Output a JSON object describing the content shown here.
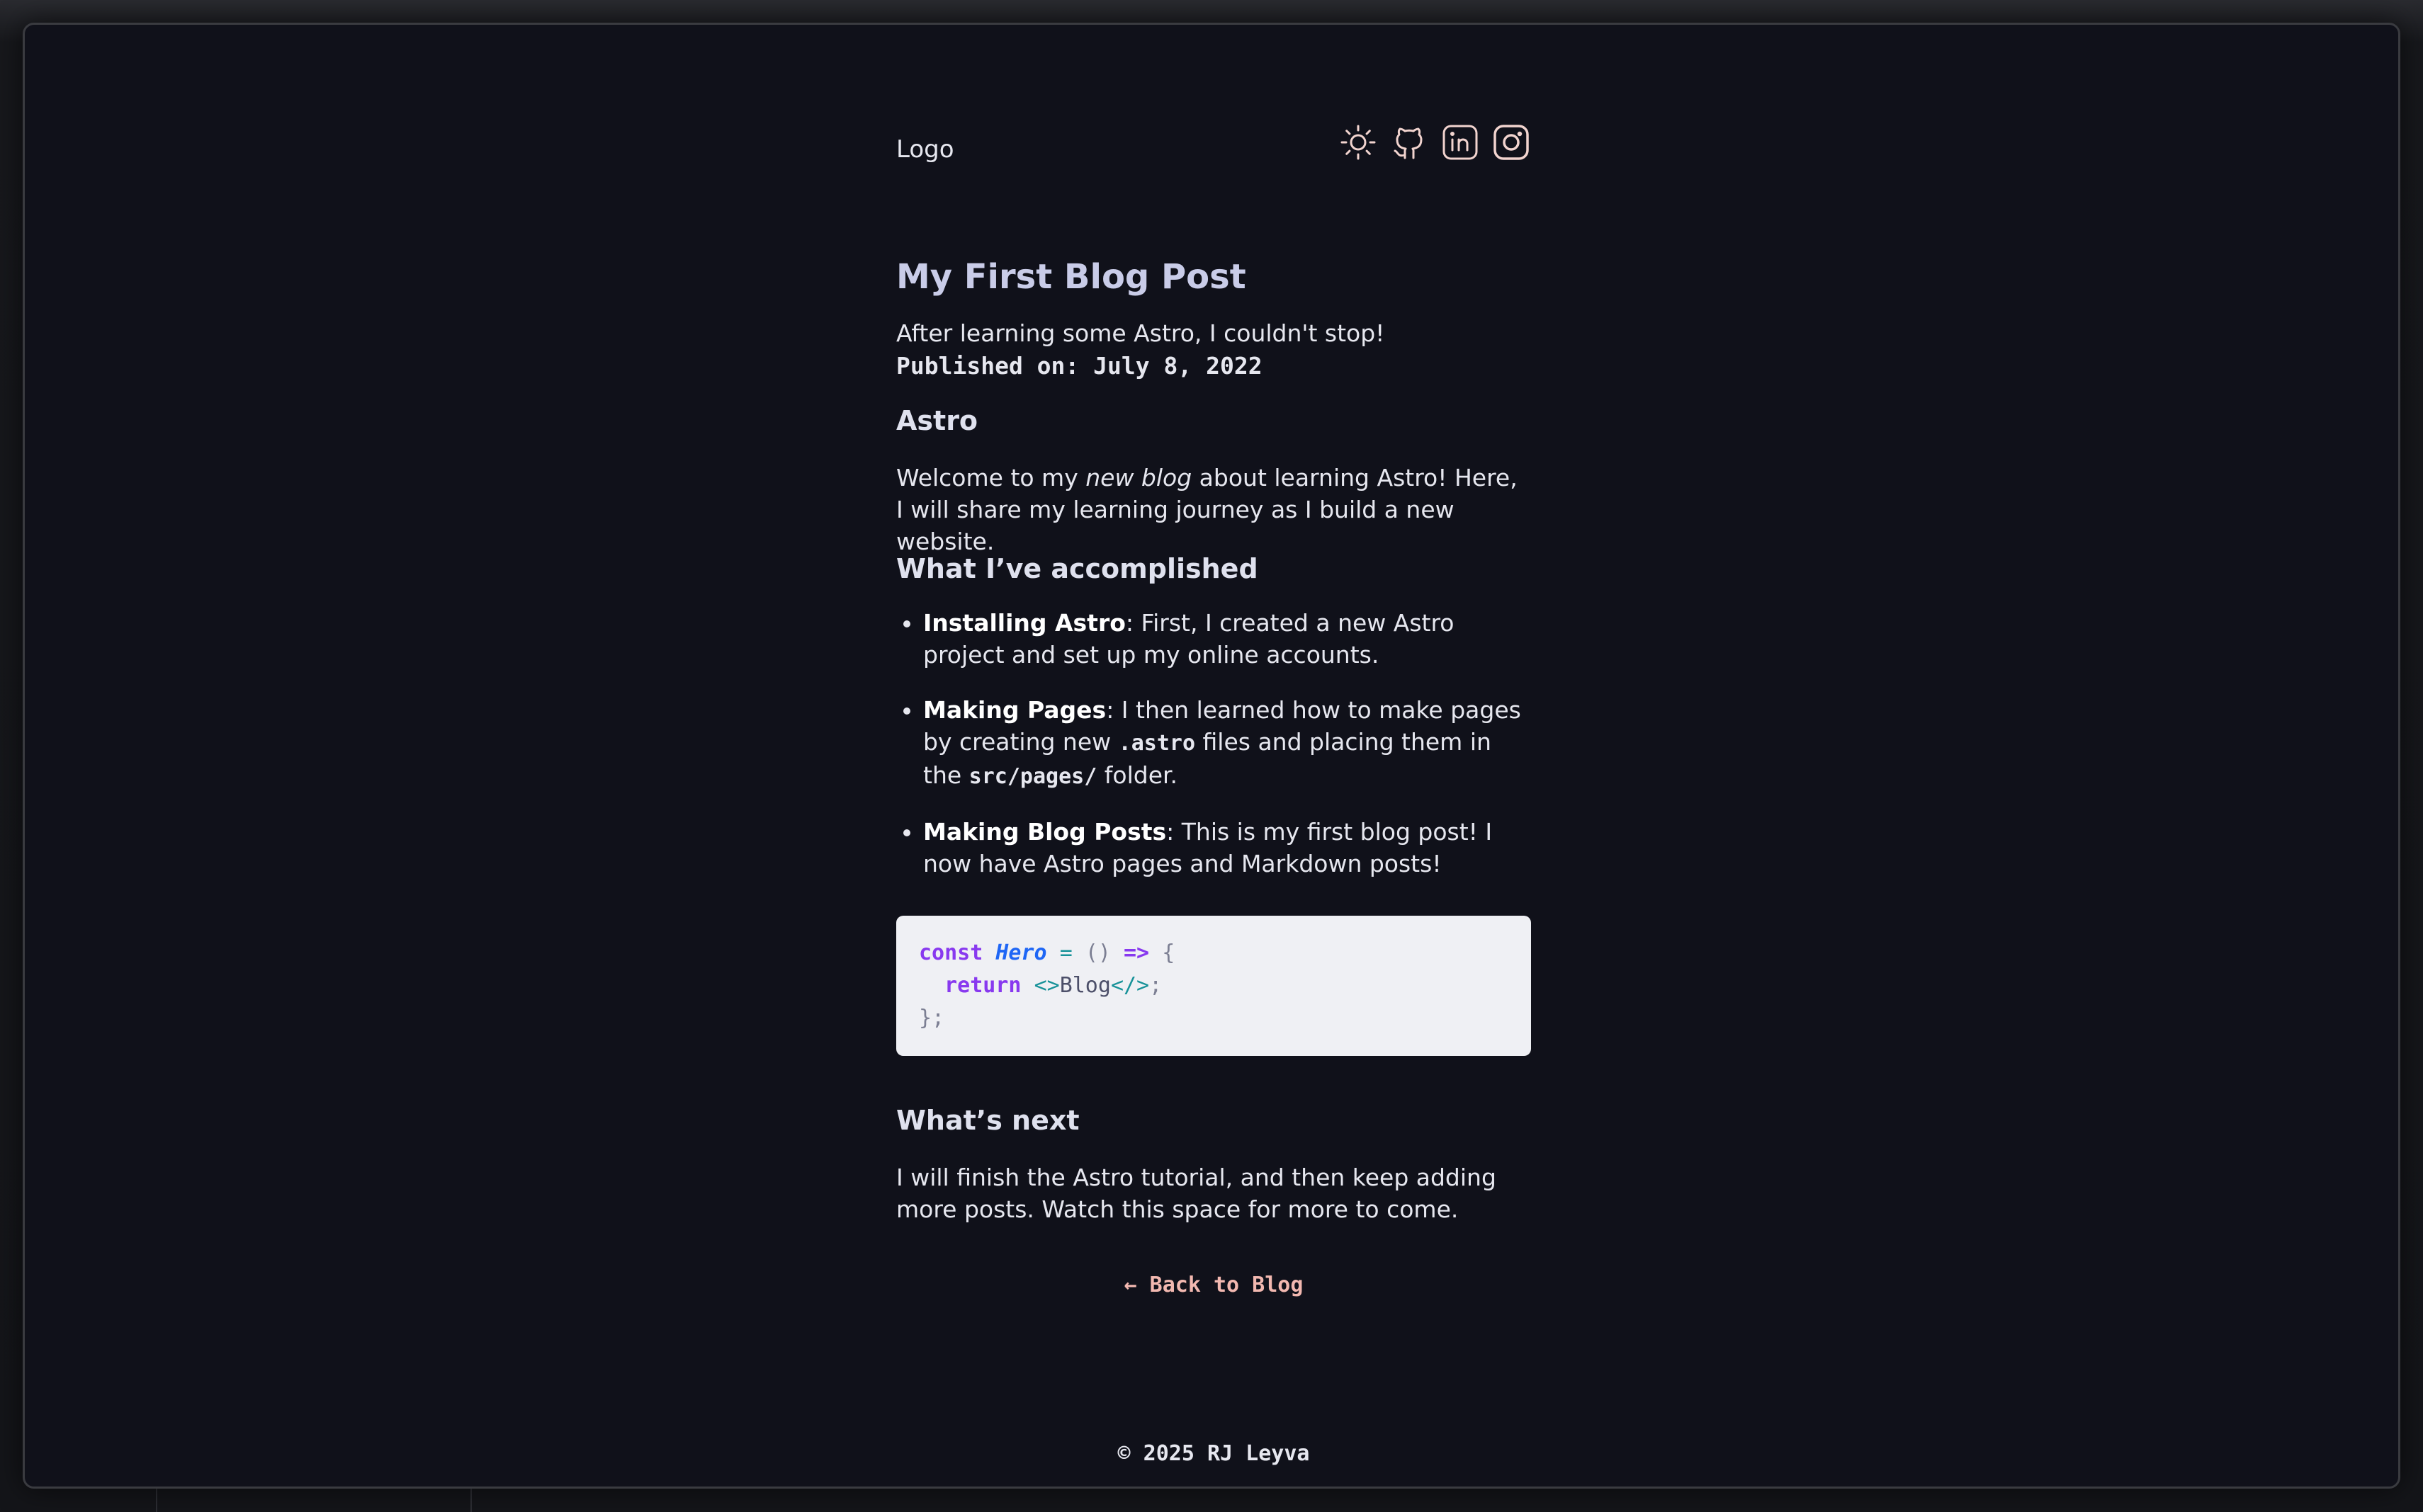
{
  "header": {
    "logo": "Logo",
    "icons": [
      "sun-icon",
      "github-icon",
      "linkedin-icon",
      "instagram-icon"
    ]
  },
  "post": {
    "title": "My First Blog Post",
    "subtitle": "After learning some Astro, I couldn't stop!",
    "published": "Published on: July 8, 2022",
    "section_astro": {
      "heading": "Astro",
      "text_before": "Welcome to my ",
      "emphasis": "new blog",
      "text_after": " about learning Astro! Here, I will share my learning journey as I build a new website."
    },
    "section_accomplished": {
      "heading": "What I’ve accomplished",
      "items": [
        {
          "title": "Installing Astro",
          "text": ": First, I created a new Astro project and set up my online accounts."
        },
        {
          "title": "Making Pages",
          "text_before": ": I then learned how to make pages by creating new ",
          "code1": ".astro",
          "text_middle": " files and placing them in the ",
          "code2": "src/pages/",
          "text_after": " folder."
        },
        {
          "title": "Making Blog Posts",
          "text": ": This is my first blog post! I now have Astro pages and Markdown posts!"
        }
      ]
    },
    "code": {
      "line1_kw": "const",
      "line1_fn": "Hero",
      "line1_op": "=",
      "line1_parens": "()",
      "line1_arrow": "=>",
      "line1_brace": "{",
      "line2_kw": "return",
      "line2_open": "<>",
      "line2_text": "Blog",
      "line2_close": "</>",
      "line2_semi": ";",
      "line3": "};"
    },
    "section_next": {
      "heading": "What’s next",
      "text": "I will finish the Astro tutorial, and then keep adding more posts. Watch this space for more to come."
    },
    "back_link": "← Back to Blog"
  },
  "footer": {
    "copyright": "© 2025 RJ Leyva"
  },
  "colors": {
    "page_bg": "#10111a",
    "accent_link": "#f2b8b0",
    "icon_stroke": "#f2d4cf",
    "title": "#c9cce8"
  }
}
